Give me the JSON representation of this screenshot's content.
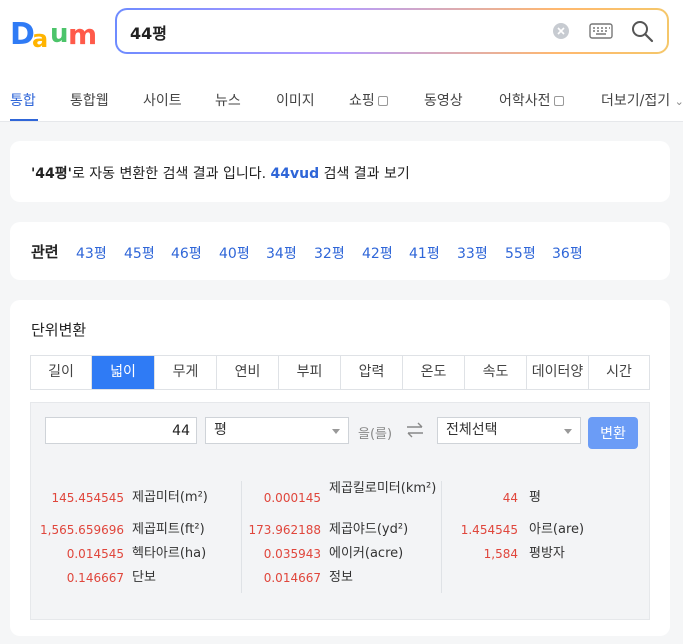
{
  "logo": {
    "text": "Daum",
    "colors": [
      "#2f7bf5",
      "#ffb400",
      "#ff5a4a",
      "#4cc46a"
    ]
  },
  "search": {
    "value": "44평"
  },
  "tabs": [
    {
      "label": "통합",
      "active": true
    },
    {
      "label": "통합웹"
    },
    {
      "label": "사이트"
    },
    {
      "label": "뉴스"
    },
    {
      "label": "이미지"
    },
    {
      "label": "쇼핑"
    },
    {
      "label": "동영상"
    },
    {
      "label": "어학사전"
    },
    {
      "label": "더보기/접기"
    }
  ],
  "notice": {
    "query": "'44평'",
    "text": "로 자동 변환한 검색 결과 입니다. ",
    "alt_query": "44vud",
    "alt_text": " 검색 결과 보기"
  },
  "related": {
    "title": "관련",
    "items": [
      "43평",
      "45평",
      "46평",
      "40평",
      "34평",
      "32평",
      "42평",
      "41평",
      "33평",
      "55평",
      "36평"
    ]
  },
  "unit_converter": {
    "title": "단위변환",
    "tabs": [
      "길이",
      "넓이",
      "무게",
      "연비",
      "부피",
      "압력",
      "온도",
      "속도",
      "데이터양",
      "시간"
    ],
    "active_tab": "넓이",
    "input_value": "44",
    "from_unit": "평",
    "particle": "을(를)",
    "to_unit": "전체선택",
    "convert_label": "변환",
    "results": [
      [
        {
          "value": "145.454545",
          "unit": "제곱미터(m²)"
        },
        {
          "value": "1,565.659696",
          "unit": "제곱피트(ft²)"
        },
        {
          "value": "0.014545",
          "unit": "헥타아르(ha)"
        },
        {
          "value": "0.146667",
          "unit": "단보"
        }
      ],
      [
        {
          "value": "0.000145",
          "unit": "제곱킬로미터(km²)"
        },
        {
          "value": "173.962188",
          "unit": "제곱야드(yd²)"
        },
        {
          "value": "0.035943",
          "unit": "에이커(acre)"
        },
        {
          "value": "0.014667",
          "unit": "정보"
        }
      ],
      [
        {
          "value": "44",
          "unit": "평"
        },
        {
          "value": "1.454545",
          "unit": "아르(are)"
        },
        {
          "value": "1,584",
          "unit": "평방자"
        }
      ]
    ],
    "value_color": "#e0463c",
    "accent": "#2f7bf5"
  }
}
